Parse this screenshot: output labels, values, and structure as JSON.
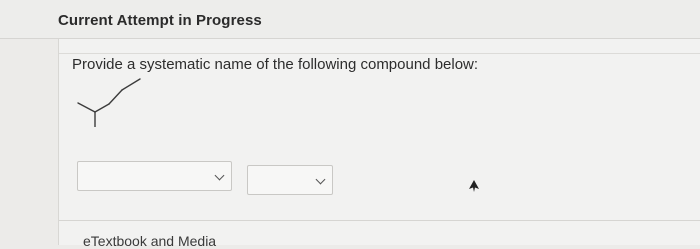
{
  "header": {
    "title": "Current Attempt in Progress"
  },
  "question": {
    "prompt": "Provide a systematic name of the following compound below:",
    "structure_icon": "skeletal-structure-drawing"
  },
  "answer": {
    "dropdown_1": {
      "selected": "",
      "icon": "chevron-down-icon"
    },
    "dropdown_2": {
      "selected": "",
      "icon": "chevron-down-icon"
    }
  },
  "footer": {
    "link_label": "eTextbook and Media"
  }
}
